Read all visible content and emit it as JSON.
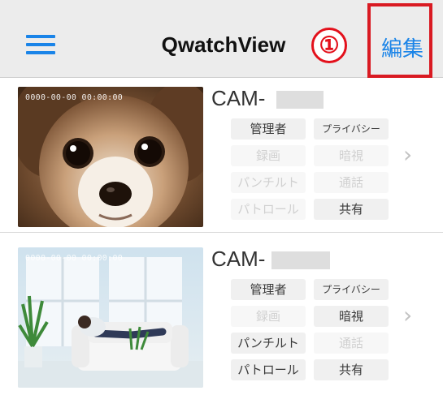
{
  "header": {
    "title": "QwatchView",
    "edit_label": "編集",
    "callout": "①"
  },
  "cameras": [
    {
      "name": "CAM-",
      "timestamp": "0000-00-00 00:00:00",
      "badges": {
        "admin": "管理者",
        "privacy": "プライバシー",
        "record": "録画",
        "night": "暗視",
        "pantilt": "パンチルト",
        "talk": "通話",
        "patrol": "パトロール",
        "share": "共有"
      }
    },
    {
      "name": "CAM-",
      "timestamp": "0000-00-00 00:00:00",
      "badges": {
        "admin": "管理者",
        "privacy": "プライバシー",
        "record": "録画",
        "night": "暗視",
        "pantilt": "パンチルト",
        "talk": "通話",
        "patrol": "パトロール",
        "share": "共有"
      }
    }
  ],
  "colors": {
    "accent": "#1a84e8",
    "highlight": "#d91a22"
  }
}
